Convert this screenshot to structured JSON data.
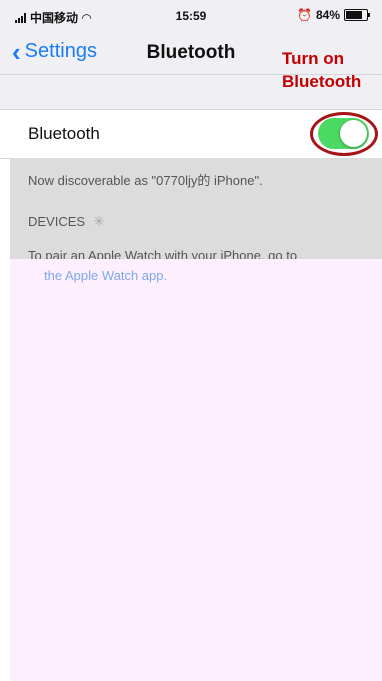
{
  "status_bar": {
    "carrier": "中国移动",
    "time": "15:59",
    "battery": "84%"
  },
  "nav": {
    "back_label": "Settings",
    "title": "Bluetooth"
  },
  "annotation": {
    "line1": "Turn on",
    "line2": "Bluetooth",
    "color": "#c40000"
  },
  "bluetooth_row": {
    "label": "Bluetooth",
    "toggle_state": "on",
    "toggle_color": "#4cd964"
  },
  "discoverable_text": "Now discoverable as \"0770ljy的 iPhone\".",
  "devices": {
    "header": "DEVICES"
  },
  "pair_text": "To pair an Apple Watch with your iPhone, go to",
  "pair_link": "the Apple Watch app."
}
